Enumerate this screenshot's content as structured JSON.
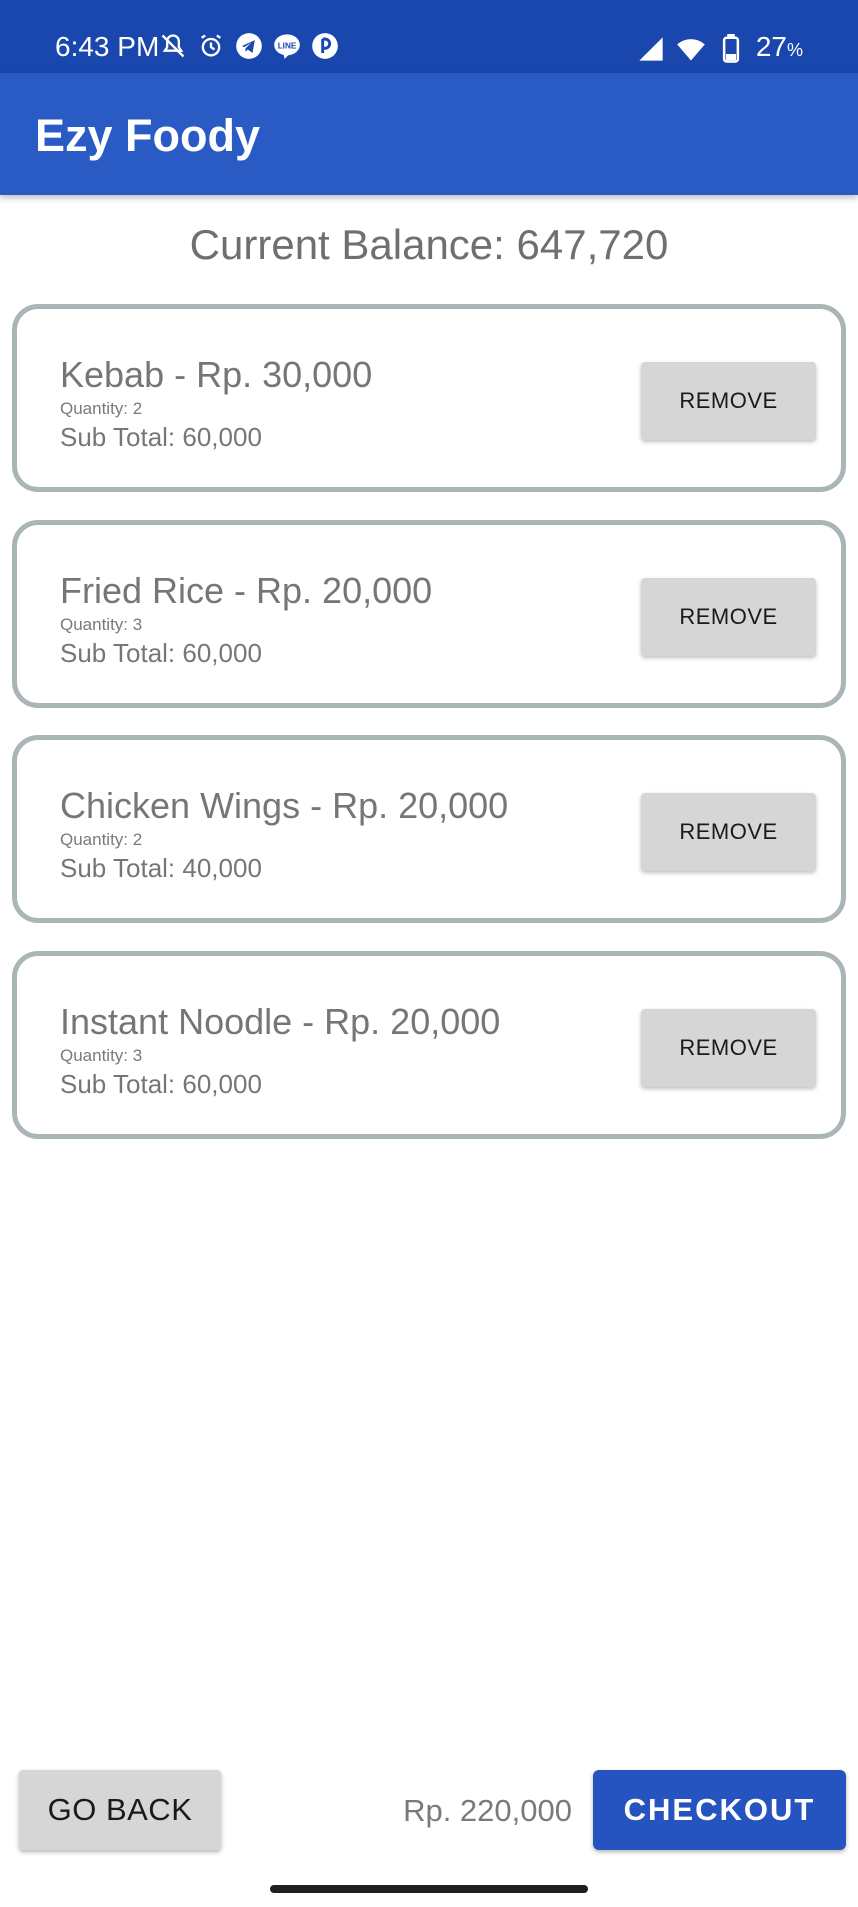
{
  "status_bar": {
    "time": "6:43 PM",
    "battery": "27",
    "battery_unit": "%",
    "icons_left": [
      "mute-icon",
      "alarm-icon",
      "telegram-icon",
      "line-icon",
      "app-icon"
    ],
    "icons_right": [
      "signal-icon",
      "wifi-icon",
      "battery-icon"
    ],
    "bg_color": "#1a47ad"
  },
  "app_bar": {
    "title": "Ezy Foody",
    "color": "#2a5ac4"
  },
  "balance_text": "Current Balance: 647,720",
  "cart": {
    "items": [
      {
        "title": "Kebab - Rp. 30,000",
        "quantity": "Quantity: 2",
        "subtotal": "Sub Total: 60,000",
        "remove_label": "REMOVE"
      },
      {
        "title": "Fried Rice - Rp. 20,000",
        "quantity": "Quantity: 3",
        "subtotal": "Sub Total: 60,000",
        "remove_label": "REMOVE"
      },
      {
        "title": "Chicken Wings - Rp. 20,000",
        "quantity": "Quantity: 2",
        "subtotal": "Sub Total: 40,000",
        "remove_label": "REMOVE"
      },
      {
        "title": "Instant Noodle - Rp. 20,000",
        "quantity": "Quantity: 3",
        "subtotal": "Sub Total: 60,000",
        "remove_label": "REMOVE"
      }
    ]
  },
  "footer": {
    "go_back_label": "GO BACK",
    "total": "Rp. 220,000",
    "checkout_label": "CHECKOUT",
    "checkout_color": "#2553c0"
  }
}
